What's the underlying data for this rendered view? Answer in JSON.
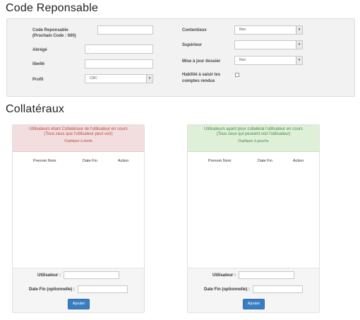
{
  "code_responsable": {
    "title": "Code Reponsable",
    "code_label": "Code Reponsable",
    "code_hint": "(Prochain Code : 000)",
    "code_value": "",
    "abrege_label": "Abrégé",
    "abrege_value": ".",
    "libelle_label": "libellé",
    "libelle_value": "",
    "profil_label": "Profil",
    "profil_value": "CRC",
    "contentieux_label": "Contentieux",
    "contentieux_value": "Non",
    "superieur_label": "Supérieur",
    "superieur_value": "",
    "mise_a_jour_label": "Mise à jour dossier",
    "mise_a_jour_value": "Non",
    "habilite_label_1": "Habilité à saisir les",
    "habilite_label_2": "comptes rendus"
  },
  "collateraux": {
    "title": "Collatéraux",
    "left": {
      "heading_1": "Utilisateurs étant Collatéraux de l'utilisateur en cours",
      "heading_2": "(Tous ceux que l'utilisateur peut voir)",
      "duplicate_link": "Dupliquer à droite",
      "columns": [
        "Prenom Nom",
        "Date Fin",
        "Action"
      ],
      "utilisateur_label": "Utilisateur :",
      "date_fin_label": "Date Fin (optionnelle) :",
      "add_button": "Ajouter"
    },
    "right": {
      "heading_1": "Utilisateurs ayant pour collatéral l'utilisateur en cours",
      "heading_2": "(Tous ceux qui peuvent voir l'utilisateur)",
      "duplicate_link": "Dupliquer à gauche",
      "columns": [
        "Prenom Nom",
        "Date Fin",
        "Action"
      ],
      "utilisateur_label": "Utilisateur :",
      "date_fin_label": "Date Fin (optionnelle) :",
      "add_button": "Ajouter"
    }
  },
  "colors": {
    "danger_bg": "#f2dede",
    "danger_text": "#b94a48",
    "success_bg": "#dff0d8",
    "success_text": "#468847",
    "primary_button": "#3a7ec2"
  }
}
